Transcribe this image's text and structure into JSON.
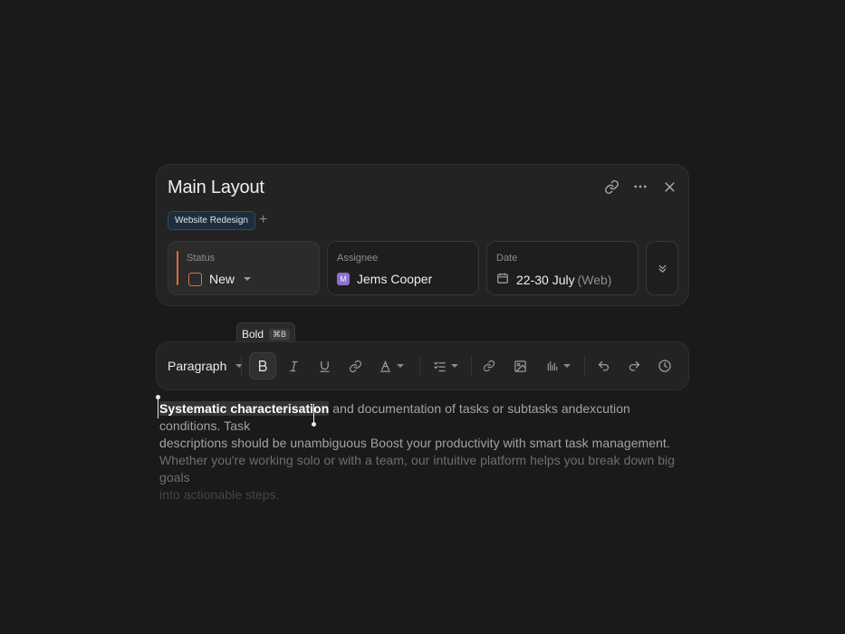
{
  "task": {
    "title": "Main Layout",
    "tag": "Website Redesign",
    "add_tag_symbol": "+"
  },
  "fields": {
    "status": {
      "label": "Status",
      "value": "New",
      "color": "#d9703b"
    },
    "assignee": {
      "label": "Assignee",
      "avatar_initial": "M",
      "value": "Jems Cooper",
      "avatar_color": "#8a6fcf"
    },
    "date": {
      "label": "Date",
      "value": "22-30 July",
      "suffix": "(Web)"
    }
  },
  "tooltip": {
    "label": "Bold",
    "shortcut": "⌘B"
  },
  "toolbar": {
    "block_type": "Paragraph",
    "buttons": [
      "bold-icon",
      "italic-icon",
      "underline-icon",
      "link-icon",
      "text-color-icon",
      "checklist-icon",
      "link-icon",
      "image-icon",
      "chart-icon",
      "undo-icon",
      "redo-icon",
      "history-icon"
    ],
    "active": "bold"
  },
  "editor": {
    "selected_text": "Systematic characterisation",
    "line1_rest": " and documentation of tasks or subtasks andexcution conditions. Task",
    "line2": "descriptions should be unambiguous Boost your productivity with smart task management.",
    "line3": "Whether you're working solo or with a team, our intuitive platform helps you break down big goals",
    "line4": "into actionable steps."
  },
  "colors": {
    "background": "#1a1a1a",
    "card": "#232323",
    "accent_status": "#d9703b",
    "tag_bg": "#1f2d3b"
  }
}
